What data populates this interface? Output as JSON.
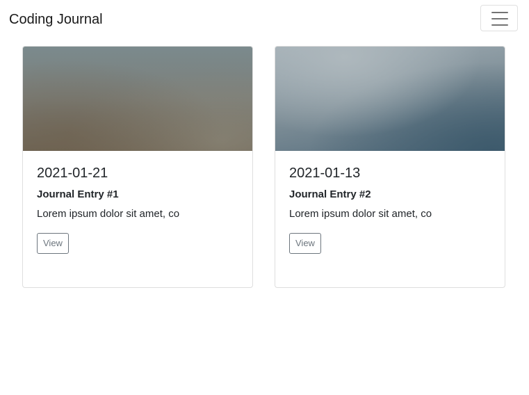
{
  "navbar": {
    "brand": "Coding Journal"
  },
  "cards": [
    {
      "date": "2021-01-21",
      "title": "Journal Entry #1",
      "excerpt": "Lorem ipsum dolor sit amet, co",
      "button_label": "View"
    },
    {
      "date": "2021-01-13",
      "title": "Journal Entry #2",
      "excerpt": "Lorem ipsum dolor sit amet, co",
      "button_label": "View"
    }
  ]
}
